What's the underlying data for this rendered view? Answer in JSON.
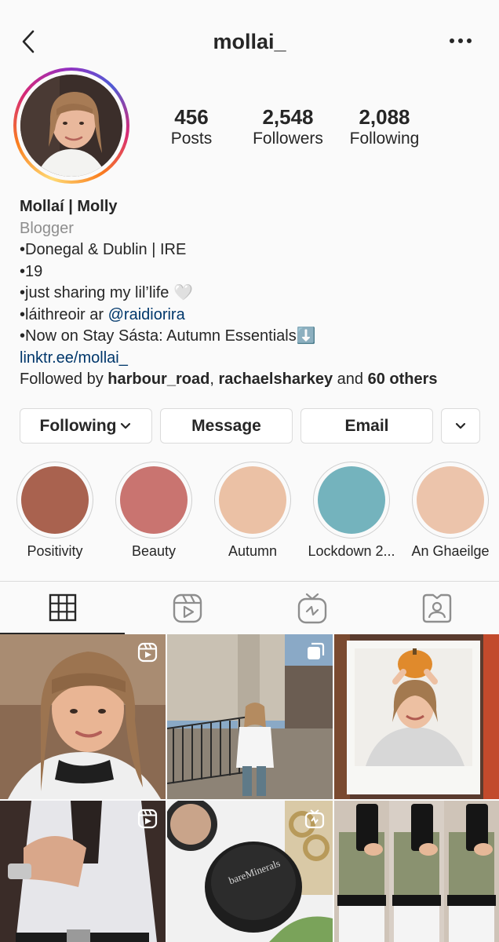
{
  "header": {
    "username": "mollai_",
    "back_icon": "chevron-left-icon",
    "more_icon": "more-horizontal-icon"
  },
  "stats": [
    {
      "count": "456",
      "label": "Posts"
    },
    {
      "count": "2,548",
      "label": "Followers"
    },
    {
      "count": "2,088",
      "label": "Following"
    }
  ],
  "bio": {
    "name": "Mollaí | Molly",
    "category": "Blogger",
    "line1": "•Donegal & Dublin | IRE",
    "line2": "•19",
    "line3": "•just sharing my lil’life",
    "line3_emoji": "🤍",
    "line4_prefix": "•láithreoir ar ",
    "line4_mention": "@raidiorira",
    "line5": "•Now on Stay Sásta: Autumn Essentials",
    "line5_emoji": "⬇️",
    "link": "linktr.ee/mollai_",
    "followed_prefix": "Followed by ",
    "followed_user1": "harbour_road",
    "followed_sep": ", ",
    "followed_user2": "rachaelsharkey",
    "followed_and": " and ",
    "followed_others": "60 others"
  },
  "actions": {
    "following_label": "Following",
    "message_label": "Message",
    "email_label": "Email"
  },
  "highlights": [
    {
      "label": "Positivity",
      "color": "#a9624f"
    },
    {
      "label": "Beauty",
      "color": "#c97470"
    },
    {
      "label": "Autumn",
      "color": "#ebc1a5"
    },
    {
      "label": "Lockdown 2...",
      "color": "#74b3bd"
    },
    {
      "label": "An Ghaeilge",
      "color": "#ecc4ab"
    }
  ],
  "tabs": [
    {
      "icon": "grid-icon"
    },
    {
      "icon": "reels-icon"
    },
    {
      "icon": "igtv-icon"
    },
    {
      "icon": "tagged-icon"
    }
  ],
  "colors": {
    "text": "#262626",
    "secondary": "#8e8e8e",
    "link": "#00376b",
    "border": "#dbdbdb",
    "background": "#fafafa"
  }
}
